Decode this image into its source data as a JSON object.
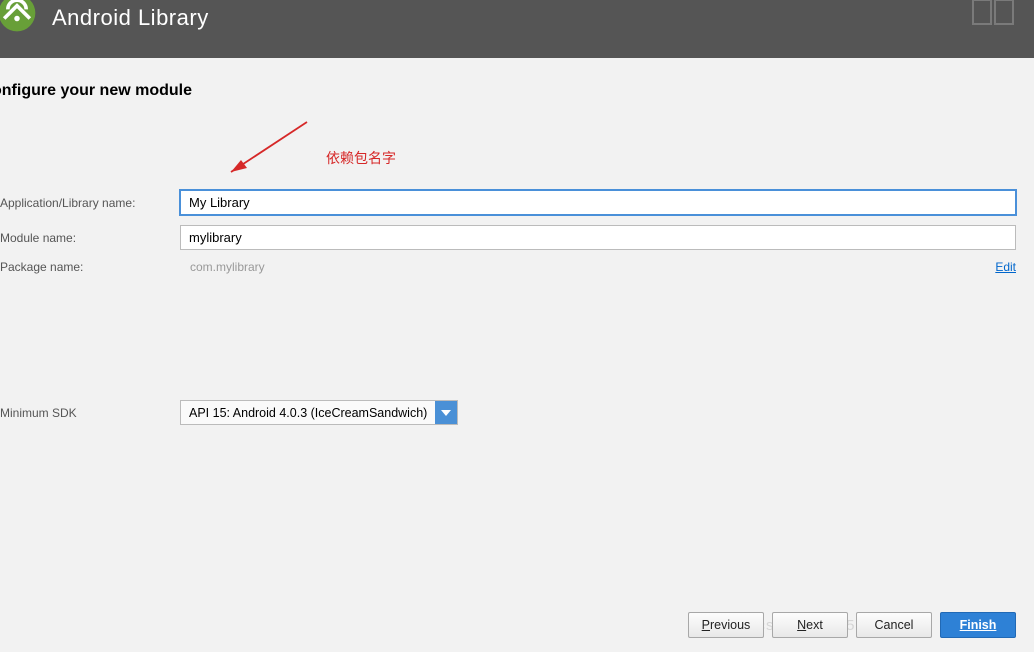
{
  "header": {
    "title": "Android Library"
  },
  "page": {
    "title": "onfigure your new module"
  },
  "annotation": {
    "text": "依赖包名字"
  },
  "form": {
    "app_name_label": "Application/Library name:",
    "app_name_value": "My Library",
    "module_name_label": "Module name:",
    "module_name_value": "mylibrary",
    "package_name_label": "Package name:",
    "package_name_value": "com.mylibrary",
    "edit_link": "Edit",
    "min_sdk_label": "Minimum SDK",
    "min_sdk_value": "API 15: Android 4.0.3 (IceCreamSandwich)"
  },
  "buttons": {
    "previous": "revious",
    "previous_m": "P",
    "next": "ext",
    "next_m": "N",
    "cancel": "Cancel",
    "finish": "Finish"
  },
  "watermark": "blog.csdn.net/qq530252869"
}
